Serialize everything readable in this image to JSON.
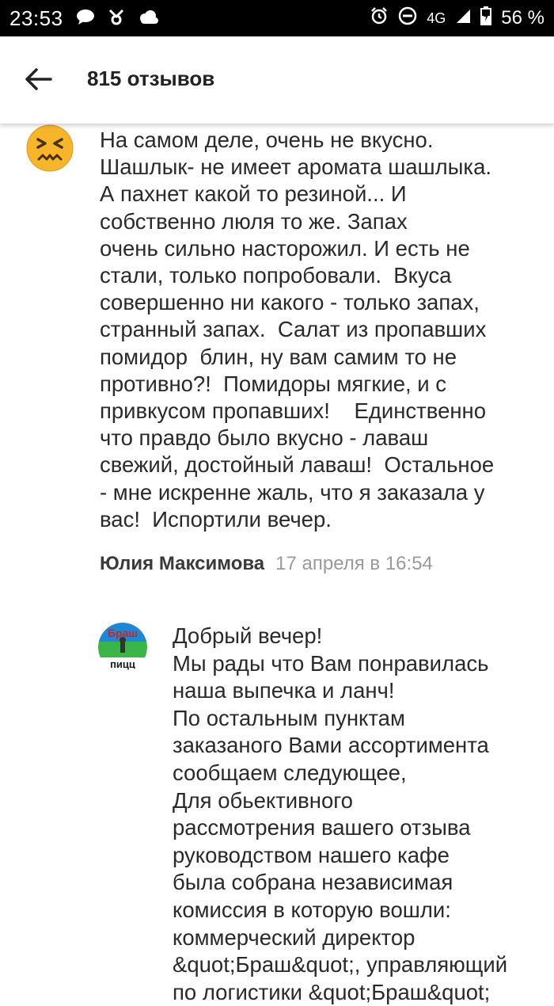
{
  "status_bar": {
    "time": "23:53",
    "network": "4G",
    "battery": "56 %"
  },
  "app_bar": {
    "title": "815 отзывов"
  },
  "review": {
    "text": "На самом деле, очень не вкусно.\nШашлык- не имеет аромата шашлыка.\nА пахнет какой то резиной... И\nсобственно люля то же. Запах\nочень сильно насторожил. И есть не\nстали, только попробовали.  Вкуса\nсовершенно ни какого - только запах,\nстранный запах.  Салат из пропавших\nпомидор  блин, ну вам самим то не\nпротивно?!  Помидоры мягкие, и с\nпривкусом пропавших!    Единственно\nчто правдо было вкусно - лаваш\nсвежий, достойный лаваш!  Остальное\n- мне искренне жаль, что я заказала у\nвас!  Испортили вечер.",
    "author": "Юлия Максимова",
    "date": "17 апреля в 16:54",
    "avatar_icon": "confounded-face-emoji"
  },
  "response": {
    "text": "Добрый вечер!\nМы рады что Вам понравилась\nнаша выпечка и ланч!\nПо остальным пунктам\nзаказаного Вами ассортимента\nсообщаем следующее,\nДля обьективного\nрассмотрения вашего отзыва\nруководством нашего кафе\nбыла собрана независимая\nкомиссия в которую вошли:\nкоммерческий директор\n&quot;Браш&quot;, управляющий\nпо логистики &quot;Браш&quot;",
    "logo_text_top": "Браш",
    "logo_text_bottom": "пицц"
  },
  "colors": {
    "status_bar_bg": "#000000",
    "emoji_yellow": "#f7b52c",
    "meta_gray": "#9a9a9a"
  }
}
